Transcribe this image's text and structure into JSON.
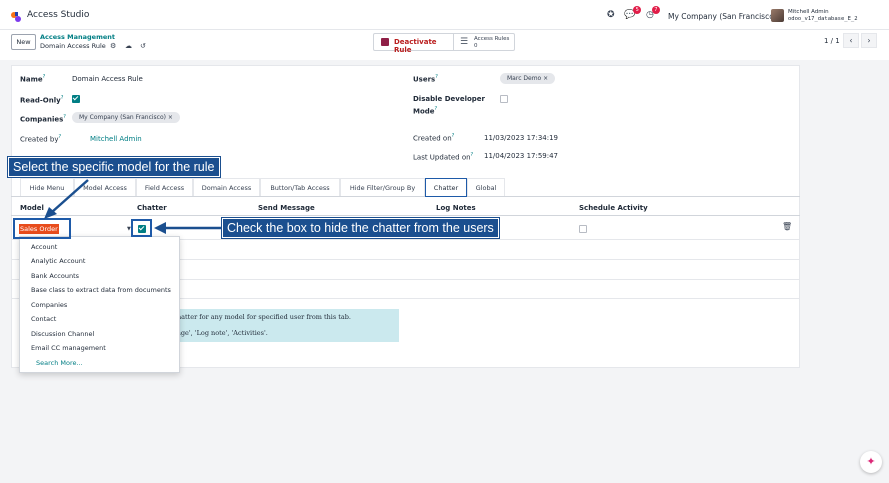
{
  "app": {
    "title": "Access Studio"
  },
  "systray": {
    "gift_icon": "gift-icon",
    "messages_count": "5",
    "activities_count": "7",
    "company": "My Company (San Francisco)",
    "user_name": "Mitchell Admin",
    "database": "odoo_v17_database_E_2"
  },
  "control": {
    "new_label": "New",
    "breadcrumb_parent": "Access Management",
    "breadcrumb_current": "Domain Access Rule",
    "deactivate_label": "Deactivate Rule",
    "access_rules_label": "Access Rules",
    "access_rules_count": "0",
    "pager": "1 / 1"
  },
  "form": {
    "name_label": "Name",
    "name_value": "Domain Access Rule",
    "readonly_label": "Read-Only",
    "readonly_checked": true,
    "companies_label": "Companies",
    "companies_tag": "My Company (San Francisco) ×",
    "created_by_label": "Created by",
    "created_by_value": "Mitchell Admin",
    "users_label": "Users",
    "users_tag": "Marc Demo ×",
    "disable_dev_label_1": "Disable Developer",
    "disable_dev_label_2": "Mode",
    "created_on_label": "Created on",
    "created_on_value": "11/03/2023 17:34:19",
    "last_updated_label": "Last Updated on",
    "last_updated_value": "11/04/2023 17:59:47",
    "help_mark": "?"
  },
  "tabs": [
    "Hide Menu",
    "Model Access",
    "Field Access",
    "Domain Access",
    "Button/Tab Access",
    "Hide Filter/Group By",
    "Chatter",
    "Global"
  ],
  "table": {
    "headers": [
      "Model",
      "Chatter",
      "Send Message",
      "Log Notes",
      "Schedule Activity"
    ],
    "row_model": "Sales Order",
    "row_chatter_checked": true
  },
  "dropdown": {
    "items": [
      "Account",
      "Analytic Account",
      "Bank Accounts",
      "Base class to extract data from documents",
      "Companies",
      "Contact",
      "Discussion Channel",
      "Email CC management"
    ],
    "search_more": "Search More..."
  },
  "info": {
    "line1": "hatter for any model for specified user from this tab.",
    "line2": "age', 'Log note', 'Activities'."
  },
  "callouts": {
    "model": "Select the specific model for the rule",
    "chatter": "Check the box to hide the chatter from the users"
  },
  "colors": {
    "accent": "#017e84",
    "callout": "#1b4f8f",
    "highlight": "#e84c1c",
    "deactivate": "#b91c1c"
  }
}
